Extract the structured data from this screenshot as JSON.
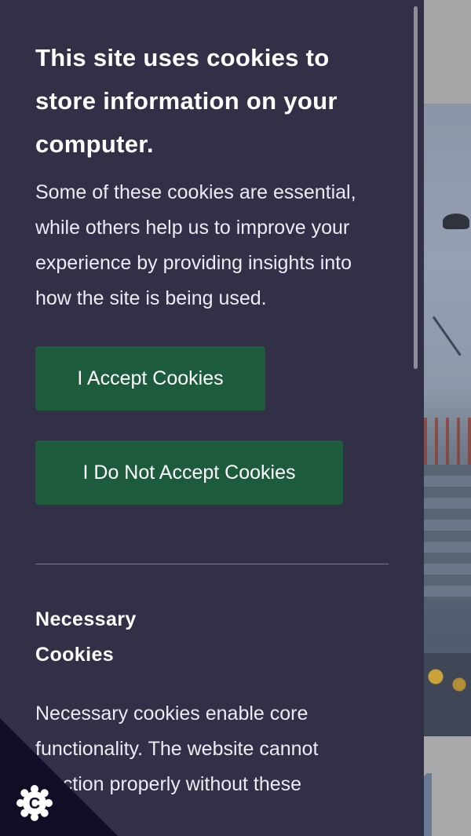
{
  "cookie_panel": {
    "title": "This site uses cookies to store information on your computer.",
    "description": "Some of these cookies are essential, while others help us to improve your experience by providing insights into how the site is being used.",
    "accept_button": "I Accept Cookies",
    "decline_button": "I Do Not Accept Cookies",
    "sections": [
      {
        "title": "Necessary Cookies",
        "description": "Necessary cookies enable core functionality. The website cannot function properly without these"
      }
    ]
  },
  "corner_widget": {
    "icon": "cookie-icon",
    "letter": "C"
  },
  "colors": {
    "panel_bg": "#323046",
    "button_bg": "#1c5c3c",
    "corner_bg": "#100d26"
  }
}
